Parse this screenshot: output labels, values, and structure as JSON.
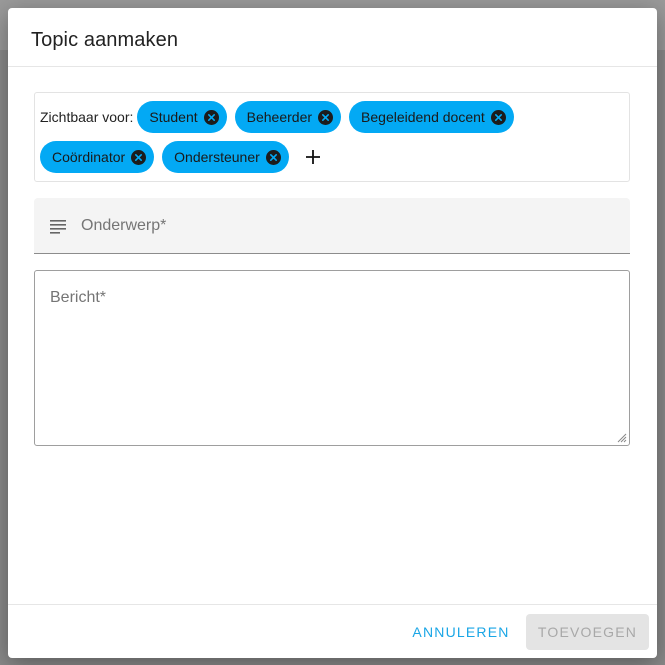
{
  "dialog": {
    "title": "Topic aanmaken"
  },
  "visibility": {
    "label": "Zichtbaar voor:",
    "chips": [
      {
        "label": "Student"
      },
      {
        "label": "Beheerder"
      },
      {
        "label": "Begeleidend docent"
      },
      {
        "label": "Coördinator"
      },
      {
        "label": "Ondersteuner"
      }
    ],
    "add_icon": "plus-icon",
    "remove_icon": "close-circle-icon",
    "chip_color": "#03a9f4"
  },
  "subject": {
    "placeholder": "Onderwerp*",
    "value": "",
    "icon": "text-subject-icon"
  },
  "message": {
    "placeholder": "Bericht*",
    "value": ""
  },
  "footer": {
    "cancel_label": "ANNULEREN",
    "add_label": "TOEVOEGEN",
    "accent_color": "#1aa6e6"
  }
}
